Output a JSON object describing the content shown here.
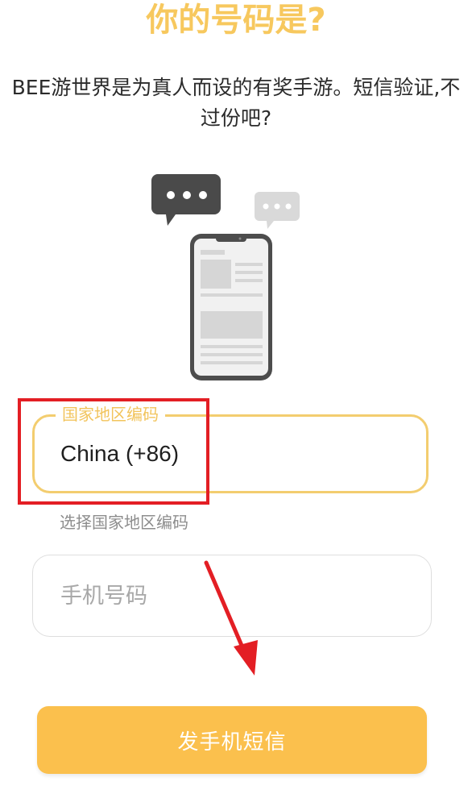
{
  "header": {
    "title": "你的号码是?",
    "subtitle": "BEE游世界是为真人而设的有奖手游。短信验证,不过份吧?"
  },
  "illustration": {
    "name": "phone-with-chat-bubbles"
  },
  "country_field": {
    "label": "国家地区编码",
    "value": "China (+86)",
    "helper": "选择国家地区编码"
  },
  "phone_field": {
    "placeholder": "手机号码",
    "value": ""
  },
  "send_button": {
    "label": "发手机短信"
  },
  "colors": {
    "accent": "#fbc04d",
    "title": "#f7c85e",
    "highlight": "#e31e24"
  }
}
